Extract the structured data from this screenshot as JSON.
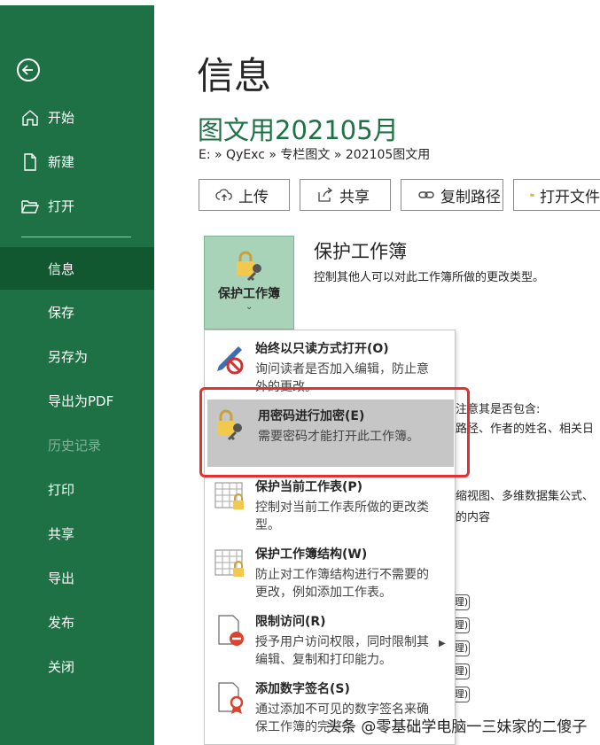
{
  "sidebar": {
    "items": [
      {
        "label": "开始"
      },
      {
        "label": "新建"
      },
      {
        "label": "打开"
      },
      {
        "label": "信息"
      },
      {
        "label": "保存"
      },
      {
        "label": "另存为"
      },
      {
        "label": "导出为PDF"
      },
      {
        "label": "历史记录"
      },
      {
        "label": "打印"
      },
      {
        "label": "共享"
      },
      {
        "label": "导出"
      },
      {
        "label": "发布"
      },
      {
        "label": "关闭"
      }
    ]
  },
  "main": {
    "page_title": "信息",
    "doc_title": "图文用202105月",
    "breadcrumb": "E: » QyExc » 专栏图文 » 202105图文用",
    "buttons": {
      "upload": "上传",
      "share": "共享",
      "copy_path": "复制路径",
      "open_folder": "打开文件"
    },
    "protect": {
      "tile_label": "保护工作簿",
      "title": "保护工作簿",
      "description": "控制其他人可以对此工作簿所做的更改类型。"
    },
    "background_text": {
      "line1": "注意其是否包含:",
      "line2": "路径、作者的姓名、相关日",
      "line3": "缩视图、多维数据集公式、",
      "line4": "的内容"
    },
    "mini_buttons": [
      "理)",
      "理)",
      "理)",
      "理)",
      "理)"
    ]
  },
  "menu": {
    "items": [
      {
        "title": "始终以只读方式打开(O)",
        "desc": "询问读者是否加入编辑，防止意外的更改。"
      },
      {
        "title": "用密码进行加密(E)",
        "desc": "需要密码才能打开此工作簿。"
      },
      {
        "title": "保护当前工作表(P)",
        "desc": "控制对当前工作表所做的更改类型。"
      },
      {
        "title": "保护工作簿结构(W)",
        "desc": "防止对工作簿结构进行不需要的更改，例如添加工作表。"
      },
      {
        "title": "限制访问(R)",
        "desc": "授予用户访问权限，同时限制其编辑、复制和打印能力。"
      },
      {
        "title": "添加数字签名(S)",
        "desc": "通过添加不可见的数字签名来确保工作簿的完整性"
      }
    ]
  },
  "watermark": "头条 @零基础学电脑一三妹家的二傻子",
  "colors": {
    "sidebar": "#1e7145",
    "sidebar_active": "#11572f",
    "accent": "#1e7145",
    "highlight": "#c6c6c6",
    "annotation_red": "#e53030"
  }
}
